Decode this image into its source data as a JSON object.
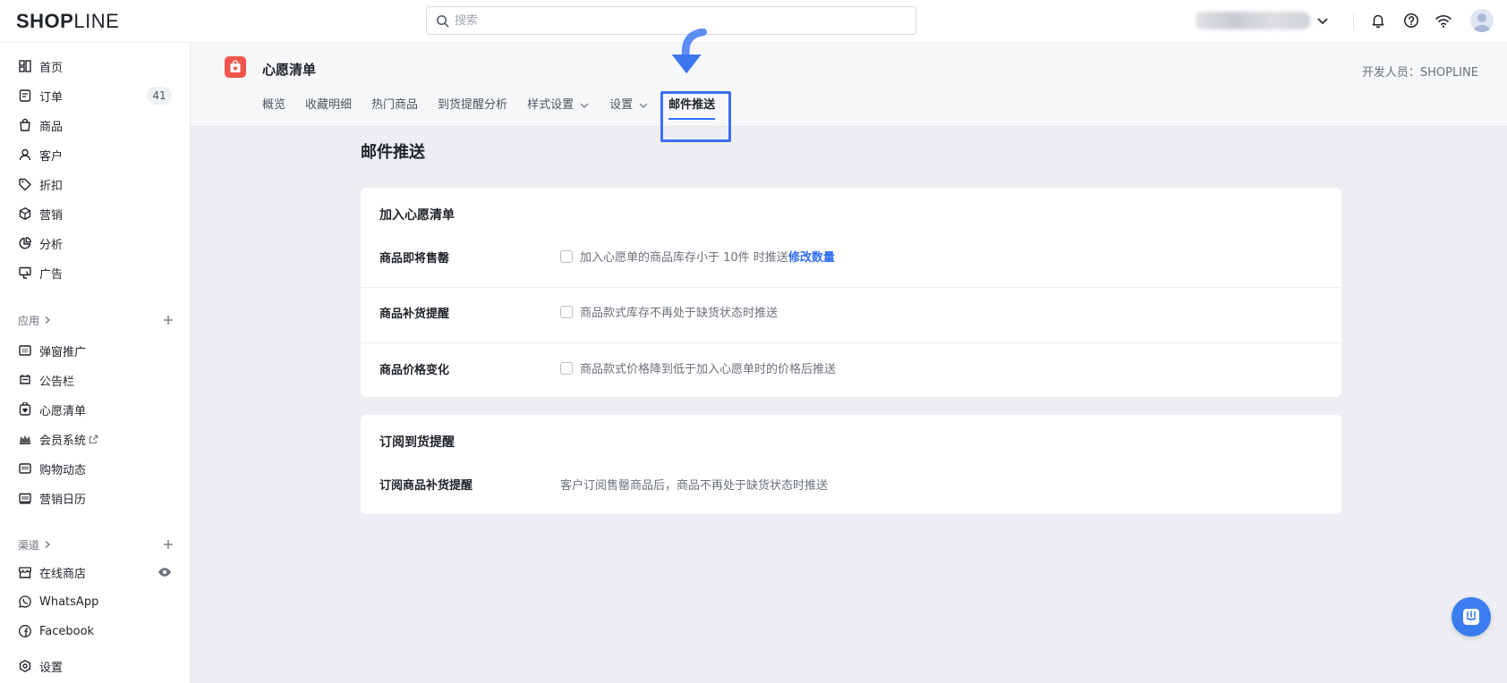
{
  "topbar": {
    "logo_bold": "SHOP",
    "logo_thin": "LINE",
    "search_placeholder": "搜索"
  },
  "sidebar": {
    "items": [
      {
        "label": "首页",
        "icon": "home-icon"
      },
      {
        "label": "订单",
        "icon": "orders-icon",
        "badge": "41"
      },
      {
        "label": "商品",
        "icon": "products-icon"
      },
      {
        "label": "客户",
        "icon": "customers-icon"
      },
      {
        "label": "折扣",
        "icon": "discount-icon"
      },
      {
        "label": "营销",
        "icon": "marketing-icon"
      },
      {
        "label": "分析",
        "icon": "analytics-icon"
      },
      {
        "label": "广告",
        "icon": "ads-icon"
      }
    ],
    "apps_section": "应用",
    "apps": [
      {
        "label": "弹窗推广",
        "icon": "popup-icon"
      },
      {
        "label": "公告栏",
        "icon": "announcement-icon"
      },
      {
        "label": "心愿清单",
        "icon": "wishlist-icon"
      },
      {
        "label": "会员系统",
        "icon": "membership-icon"
      },
      {
        "label": "购物动态",
        "icon": "shopping-feed-icon"
      },
      {
        "label": "营销日历",
        "icon": "calendar-icon"
      }
    ],
    "channels_section": "渠道",
    "channels": [
      {
        "label": "在线商店",
        "icon": "store-icon"
      },
      {
        "label": "WhatsApp",
        "icon": "whatsapp-icon"
      },
      {
        "label": "Facebook",
        "icon": "facebook-icon"
      }
    ],
    "settings": "设置"
  },
  "app_header": {
    "title": "心愿清单",
    "developer": "开发人员：SHOPLINE",
    "tabs": [
      {
        "label": "概览",
        "dropdown": false
      },
      {
        "label": "收藏明细",
        "dropdown": false
      },
      {
        "label": "热门商品",
        "dropdown": false
      },
      {
        "label": "到货提醒分析",
        "dropdown": false
      },
      {
        "label": "样式设置",
        "dropdown": true
      },
      {
        "label": "设置",
        "dropdown": true
      },
      {
        "label": "邮件推送",
        "dropdown": false,
        "active": true
      }
    ]
  },
  "page": {
    "title": "邮件推送",
    "card1": {
      "title": "加入心愿清单",
      "rows": [
        {
          "label": "商品即将售罄",
          "text": "加入心愿单的商品库存小于 10件 时推送",
          "link": "修改数量"
        },
        {
          "label": "商品补货提醒",
          "text": "商品款式库存不再处于缺货状态时推送"
        },
        {
          "label": "商品价格变化",
          "text": "商品款式价格降到低于加入心愿单时的价格后推送"
        }
      ]
    },
    "card2": {
      "title": "订阅到货提醒",
      "rows": [
        {
          "label": "订阅商品补货提醒",
          "text": "客户订阅售罄商品后，商品不再处于缺货状态时推送"
        }
      ]
    }
  },
  "colors": {
    "accent": "#2f6df6",
    "highlight": "#3d6ef5",
    "app_icon": "#f2554c",
    "chat": "#3b7cf0"
  }
}
